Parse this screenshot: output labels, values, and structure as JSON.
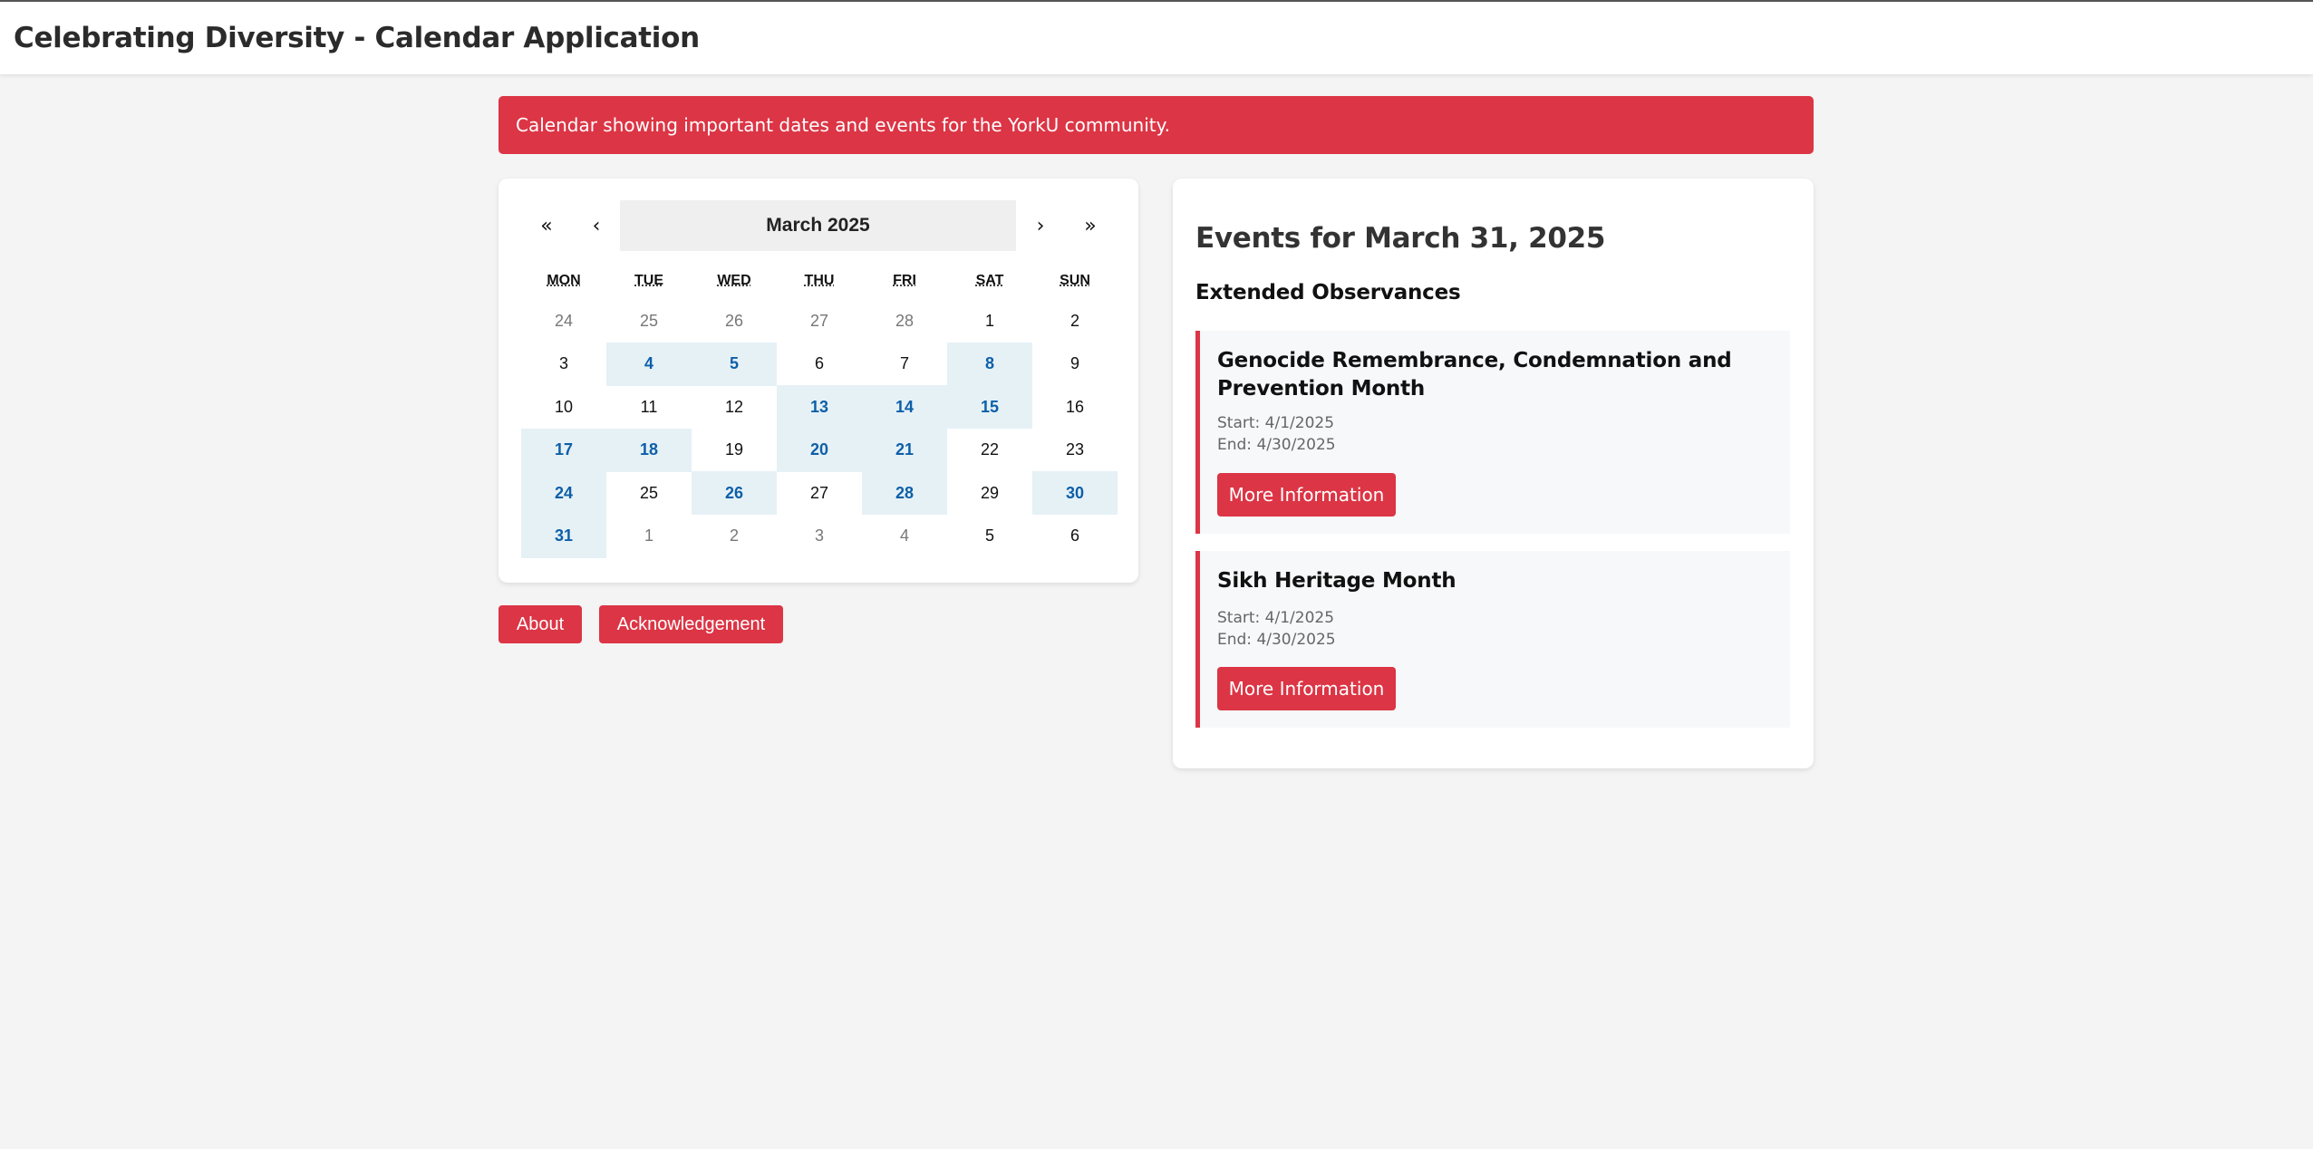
{
  "app_title": "Celebrating Diversity - Calendar Application",
  "banner_text": "Calendar showing important dates and events for the YorkU community.",
  "calendar": {
    "nav": {
      "prev2": "«",
      "prev": "‹",
      "label": "March 2025",
      "next": "›",
      "next2": "»"
    },
    "weekdays": [
      "MON",
      "TUE",
      "WED",
      "THU",
      "FRI",
      "SAT",
      "SUN"
    ],
    "weeks": [
      [
        {
          "d": "24",
          "t": "other"
        },
        {
          "d": "25",
          "t": "other"
        },
        {
          "d": "26",
          "t": "other"
        },
        {
          "d": "27",
          "t": "other"
        },
        {
          "d": "28",
          "t": "other"
        },
        {
          "d": "1",
          "t": ""
        },
        {
          "d": "2",
          "t": ""
        }
      ],
      [
        {
          "d": "3",
          "t": ""
        },
        {
          "d": "4",
          "t": "event"
        },
        {
          "d": "5",
          "t": "event"
        },
        {
          "d": "6",
          "t": ""
        },
        {
          "d": "7",
          "t": ""
        },
        {
          "d": "8",
          "t": "event"
        },
        {
          "d": "9",
          "t": ""
        }
      ],
      [
        {
          "d": "10",
          "t": ""
        },
        {
          "d": "11",
          "t": ""
        },
        {
          "d": "12",
          "t": ""
        },
        {
          "d": "13",
          "t": "event"
        },
        {
          "d": "14",
          "t": "event"
        },
        {
          "d": "15",
          "t": "event"
        },
        {
          "d": "16",
          "t": ""
        }
      ],
      [
        {
          "d": "17",
          "t": "event"
        },
        {
          "d": "18",
          "t": "event"
        },
        {
          "d": "19",
          "t": ""
        },
        {
          "d": "20",
          "t": "event"
        },
        {
          "d": "21",
          "t": "event"
        },
        {
          "d": "22",
          "t": ""
        },
        {
          "d": "23",
          "t": ""
        }
      ],
      [
        {
          "d": "24",
          "t": "event"
        },
        {
          "d": "25",
          "t": ""
        },
        {
          "d": "26",
          "t": "event"
        },
        {
          "d": "27",
          "t": ""
        },
        {
          "d": "28",
          "t": "event"
        },
        {
          "d": "29",
          "t": ""
        },
        {
          "d": "30",
          "t": "event"
        }
      ],
      [
        {
          "d": "31",
          "t": "event"
        },
        {
          "d": "1",
          "t": "other"
        },
        {
          "d": "2",
          "t": "other"
        },
        {
          "d": "3",
          "t": "other"
        },
        {
          "d": "4",
          "t": "other"
        },
        {
          "d": "5",
          "t": ""
        },
        {
          "d": "6",
          "t": ""
        }
      ]
    ]
  },
  "buttons": {
    "about": "About",
    "acknowledgement": "Acknowledgement"
  },
  "events_panel": {
    "title": "Events for March 31, 2025",
    "section_title": "Extended Observances",
    "events": [
      {
        "name": "Genocide Remembrance, Condemnation and Prevention Month",
        "start": "Start: 4/1/2025",
        "end": "End: 4/30/2025",
        "button": "More Information"
      },
      {
        "name": "Sikh Heritage Month",
        "start": "Start: 4/1/2025",
        "end": "End: 4/30/2025",
        "button": "More Information"
      }
    ]
  },
  "colors": {
    "accent": "#dc3545",
    "event_day_bg": "#e6f1f6",
    "event_day_text": "#0d5fa8"
  }
}
